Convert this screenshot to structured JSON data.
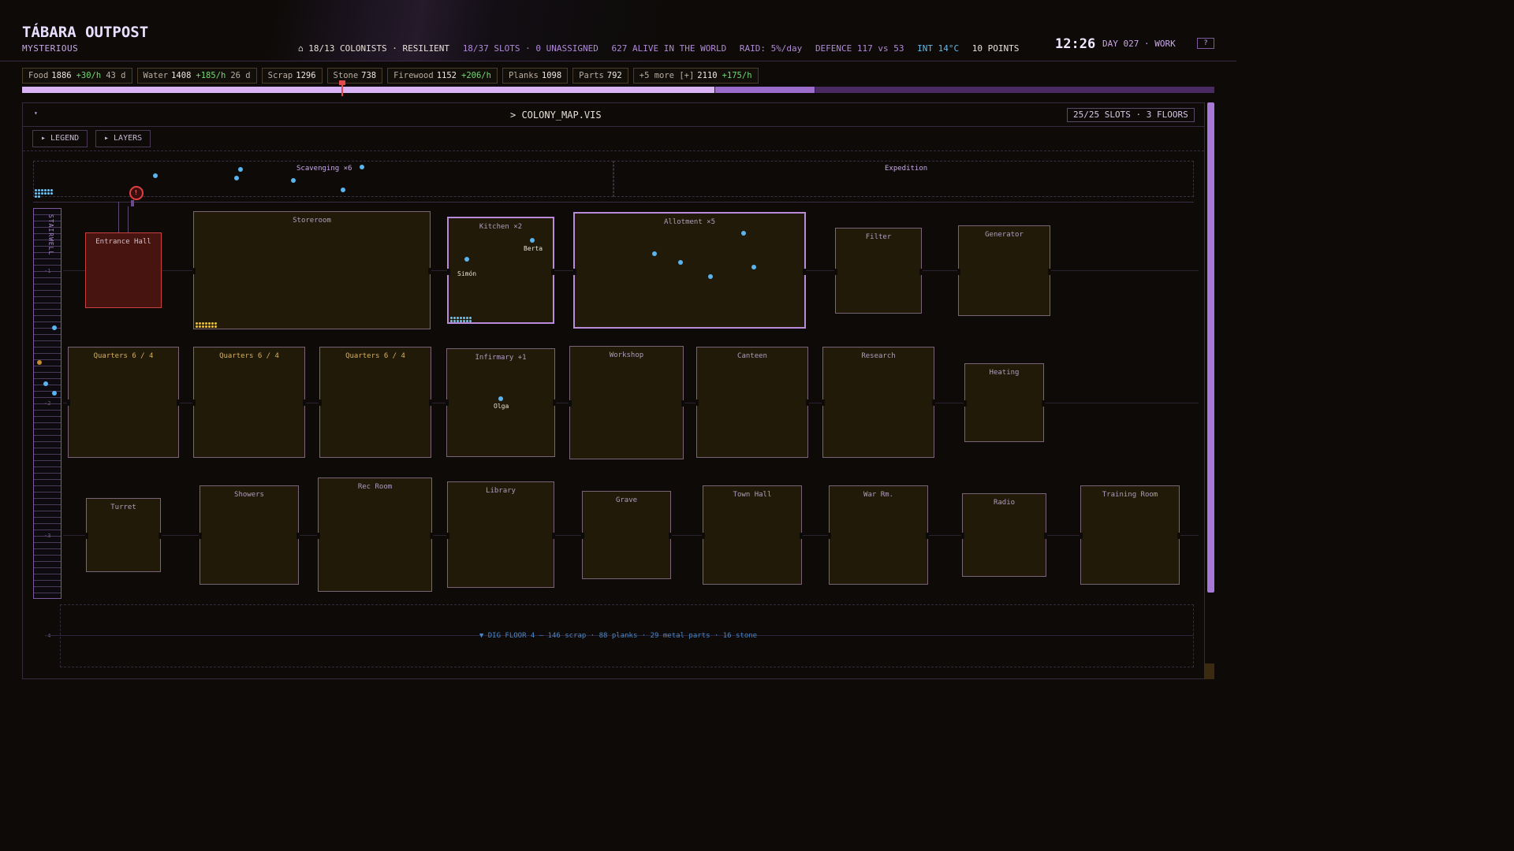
{
  "header": {
    "title": "TÁBARA OUTPOST",
    "subtitle": "MYSTERIOUS",
    "colonists": "⌂ 18/13 COLONISTS · RESILIENT",
    "slots": "18/37 SLOTS · 0 UNASSIGNED",
    "alive": "627 ALIVE IN THE WORLD",
    "raid": "RAID: 5%/day",
    "defence": "DEFENCE 117 vs 53",
    "temp": "INT 14°C",
    "points": "10 POINTS",
    "clock": "12:26",
    "day": "DAY 027 · WORK",
    "help": "?"
  },
  "resources": [
    {
      "name": "Food",
      "value": "1886",
      "rate": "+30/h",
      "days": "43 d"
    },
    {
      "name": "Water",
      "value": "1408",
      "rate": "+185/h",
      "days": "26 d"
    },
    {
      "name": "Scrap",
      "value": "1296",
      "rate": "",
      "days": ""
    },
    {
      "name": "Stone",
      "value": "738",
      "rate": "",
      "days": ""
    },
    {
      "name": "Firewood",
      "value": "1152",
      "rate": "+206/h",
      "days": ""
    },
    {
      "name": "Planks",
      "value": "1098",
      "rate": "",
      "days": ""
    },
    {
      "name": "Parts",
      "value": "792",
      "rate": "",
      "days": ""
    },
    {
      "name": "+5 more [+]",
      "value": "2110",
      "rate": "+175/h",
      "days": ""
    }
  ],
  "timeline": {
    "current_fraction": 0.268
  },
  "map": {
    "title": "> COLONY_MAP.VIS",
    "collapse": "▾",
    "slots_badge": "25/25 SLOTS · 3 FLOORS",
    "legend_btn": "▸ LEGEND",
    "layers_btn": "▸ LAYERS",
    "stairwell": "STAIRWELL",
    "surface_left": "Scavenging ×6",
    "surface_right": "Expedition",
    "dig": "▼ DIG FLOOR 4 — 146 scrap · 88 planks · 29 metal parts · 16 stone",
    "floor_labels": [
      "-1",
      "-2",
      "-3",
      "-4"
    ]
  },
  "rooms": {
    "entrance": "Entrance Hall",
    "storeroom": "Storeroom",
    "kitchen": "Kitchen ×2",
    "allotment": "Allotment ×5",
    "filter": "Filter",
    "generator": "Generator",
    "quarters1": "Quarters 6 / 4",
    "quarters2": "Quarters 6 / 4",
    "quarters3": "Quarters 6 / 4",
    "infirmary": "Infirmary +1",
    "workshop": "Workshop",
    "canteen": "Canteen",
    "research": "Research",
    "heating": "Heating",
    "turret": "Turret",
    "showers": "Showers",
    "recroom": "Rec Room",
    "library": "Library",
    "grave": "Grave",
    "townhall": "Town Hall",
    "warroom": "War Rm.",
    "radio": "Radio",
    "training": "Training Room"
  },
  "people": {
    "berta": "Berta",
    "simon": "Simón",
    "olga": "Olga"
  },
  "alert": "!",
  "colors": {
    "accent": "#b88ad8",
    "dot": "#5ab4f0",
    "danger": "#c84040",
    "room_fill": "#221a08"
  }
}
